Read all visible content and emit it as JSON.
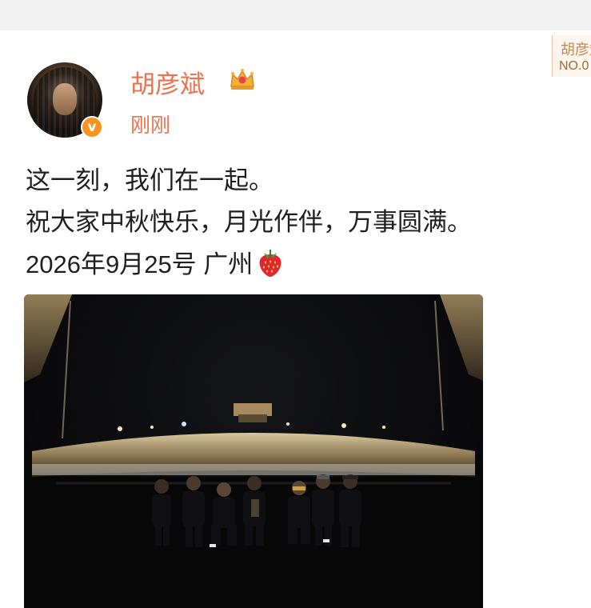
{
  "ranking_badge": {
    "name": "胡彦斌",
    "rank": "NO.0"
  },
  "post": {
    "author": "胡彦斌",
    "timestamp": "刚刚",
    "verified_label": "v",
    "lines": [
      "这一刻，我们在一起。",
      "祝大家中秋快乐，月光作伴，万事圆满。",
      "2026年9月25号 广州"
    ],
    "emoji": "strawberry-icon",
    "member_icon": "crown-icon",
    "image": "concert-stage-group-photo"
  },
  "colors": {
    "username": "#eb7350",
    "verified": "#f7931e",
    "text": "#1f1f1f"
  }
}
